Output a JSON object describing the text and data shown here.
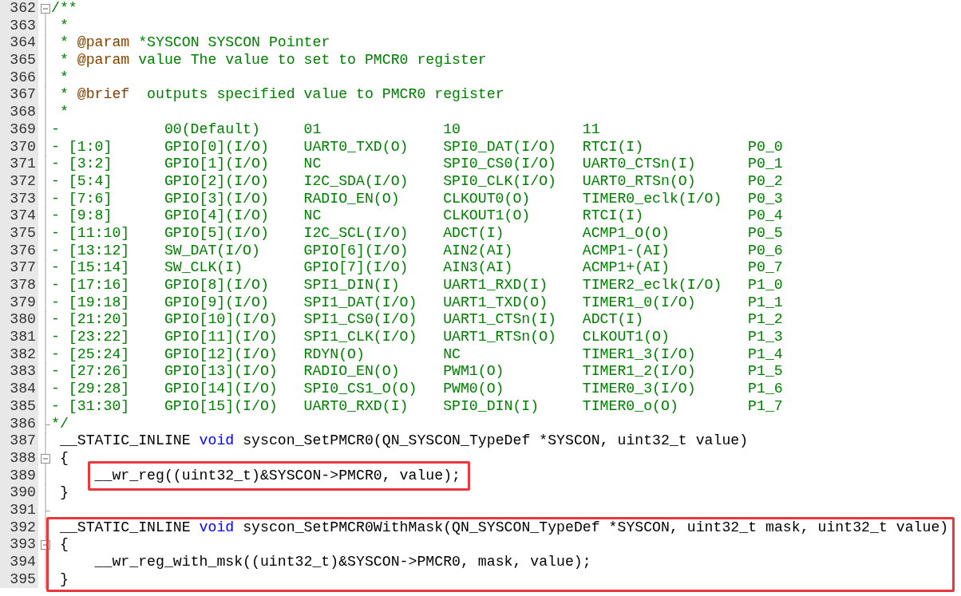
{
  "editor": {
    "blocks": [
      {
        "kind": "plain",
        "lines": [
          {
            "number": "362",
            "expanded": true,
            "segments": [
              {
                "kind": "comment",
                "text": "/**"
              }
            ]
          },
          {
            "number": "363",
            "segments": [
              {
                "kind": "comment",
                "text": " *"
              }
            ]
          },
          {
            "number": "364",
            "segments": [
              {
                "kind": "comment",
                "text": " * "
              },
              {
                "kind": "doctag",
                "text": "@param"
              },
              {
                "kind": "comment",
                "text": " *SYSCON SYSCON Pointer"
              }
            ]
          },
          {
            "number": "365",
            "segments": [
              {
                "kind": "comment",
                "text": " * "
              },
              {
                "kind": "doctag",
                "text": "@param"
              },
              {
                "kind": "comment",
                "text": " value The value to set to PMCR0 register"
              }
            ]
          },
          {
            "number": "366",
            "segments": [
              {
                "kind": "comment",
                "text": " *"
              }
            ]
          },
          {
            "number": "367",
            "segments": [
              {
                "kind": "comment",
                "text": " * "
              },
              {
                "kind": "doctag",
                "text": "@brief"
              },
              {
                "kind": "comment",
                "text": "  outputs specified value to PMCR0 register"
              }
            ]
          },
          {
            "number": "368",
            "segments": [
              {
                "kind": "comment",
                "text": " *"
              }
            ]
          },
          {
            "number": "369",
            "cells": [
              "-",
              "00(Default)",
              "01",
              "10",
              "11"
            ]
          },
          {
            "number": "370",
            "cells": [
              "- [1:0]",
              "GPIO[0](I/O)",
              "UART0_TXD(O)",
              "SPI0_DAT(I/O)",
              "RTCI(I)",
              "P0_0"
            ]
          },
          {
            "number": "371",
            "cells": [
              "- [3:2]",
              "GPIO[1](I/O)",
              "NC",
              "SPI0_CS0(I/O)",
              "UART0_CTSn(I)",
              "P0_1"
            ]
          },
          {
            "number": "372",
            "cells": [
              "- [5:4]",
              "GPIO[2](I/O)",
              "I2C_SDA(I/O)",
              "SPI0_CLK(I/O)",
              "UART0_RTSn(O)",
              "P0_2"
            ]
          },
          {
            "number": "373",
            "cells": [
              "- [7:6]",
              "GPIO[3](I/O)",
              "RADIO_EN(O)",
              "CLKOUT0(O)",
              "TIMER0_eclk(I/O)",
              "P0_3"
            ]
          },
          {
            "number": "374",
            "cells": [
              "- [9:8]",
              "GPIO[4](I/O)",
              "NC",
              "CLKOUT1(O)",
              "RTCI(I)",
              "P0_4"
            ]
          },
          {
            "number": "375",
            "cells": [
              "- [11:10]",
              "GPIO[5](I/O)",
              "I2C_SCL(I/O)",
              "ADCT(I)",
              "ACMP1_O(O)",
              "P0_5"
            ]
          },
          {
            "number": "376",
            "cells": [
              "- [13:12]",
              "SW_DAT(I/O)",
              "GPIO[6](I/O)",
              "AIN2(AI)",
              "ACMP1-(AI)",
              "P0_6"
            ]
          },
          {
            "number": "377",
            "cells": [
              "- [15:14]",
              "SW_CLK(I)",
              "GPIO[7](I/O)",
              "AIN3(AI)",
              "ACMP1+(AI)",
              "P0_7"
            ]
          },
          {
            "number": "378",
            "cells": [
              "- [17:16]",
              "GPIO[8](I/O)",
              "SPI1_DIN(I)",
              "UART1_RXD(I)",
              "TIMER2_eclk(I/O)",
              "P1_0"
            ]
          },
          {
            "number": "379",
            "cells": [
              "- [19:18]",
              "GPIO[9](I/O)",
              "SPI1_DAT(I/O)",
              "UART1_TXD(O)",
              "TIMER1_0(I/O)",
              "P1_1"
            ]
          },
          {
            "number": "380",
            "cells": [
              "- [21:20]",
              "GPIO[10](I/O)",
              "SPI1_CS0(I/O)",
              "UART1_CTSn(I)",
              "ADCT(I)",
              "P1_2"
            ]
          },
          {
            "number": "381",
            "cells": [
              "- [23:22]",
              "GPIO[11](I/O)",
              "SPI1_CLK(I/O)",
              "UART1_RTSn(O)",
              "CLKOUT1(O)",
              "P1_3"
            ]
          },
          {
            "number": "382",
            "cells": [
              "- [25:24]",
              "GPIO[12](I/O)",
              "RDYN(O)",
              "NC",
              "TIMER1_3(I/O)",
              "P1_4"
            ]
          },
          {
            "number": "383",
            "cells": [
              "- [27:26]",
              "GPIO[13](I/O)",
              "RADIO_EN(O)",
              "PWM1(O)",
              "TIMER1_2(I/O)",
              "P1_5"
            ]
          },
          {
            "number": "384",
            "cells": [
              "- [29:28]",
              "GPIO[14](I/O)",
              "SPI0_CS1_O(O)",
              "PWM0(O)",
              "TIMER0_3(I/O)",
              "P1_6"
            ]
          },
          {
            "number": "385",
            "cells": [
              "- [31:30]",
              "GPIO[15](I/O)",
              "UART0_RXD(I)",
              "SPI0_DIN(I)",
              "TIMER0_o(O)",
              "P1_7"
            ]
          },
          {
            "number": "386",
            "fold_end": true,
            "segments": [
              {
                "kind": "comment",
                "text": "*/"
              }
            ]
          },
          {
            "number": "387",
            "segments": [
              {
                "kind": "plain",
                "text": " __STATIC_INLINE "
              },
              {
                "kind": "keyword",
                "text": "void"
              },
              {
                "kind": "plain",
                "text": " syscon_SetPMCR0(QN_SYSCON_TypeDef *SYSCON, uint32_t value)"
              }
            ]
          },
          {
            "number": "388",
            "expanded": true,
            "segments": [
              {
                "kind": "plain",
                "text": " {"
              }
            ]
          }
        ]
      },
      {
        "kind": "boxed-text",
        "lines": [
          {
            "number": "389",
            "segments": [
              {
                "kind": "plain",
                "text": "     __wr_reg((uint32_t)&SYSCON->PMCR0, value);"
              }
            ]
          }
        ]
      },
      {
        "kind": "plain",
        "lines": [
          {
            "number": "390",
            "segments": [
              {
                "kind": "plain",
                "text": " }"
              }
            ]
          },
          {
            "number": "391",
            "fold_end": true
          }
        ]
      },
      {
        "kind": "boxed-block",
        "lines": [
          {
            "number": "392",
            "segments": [
              {
                "kind": "plain",
                "text": " __STATIC_INLINE "
              },
              {
                "kind": "keyword",
                "text": "void"
              },
              {
                "kind": "plain",
                "text": " syscon_SetPMCR0WithMask(QN_SYSCON_TypeDef *SYSCON, uint32_t mask, uint32_t value)"
              }
            ]
          },
          {
            "number": "393",
            "expanded": true,
            "segments": [
              {
                "kind": "plain",
                "text": " {"
              }
            ]
          },
          {
            "number": "394",
            "segments": [
              {
                "kind": "plain",
                "text": "     __wr_reg_with_msk((uint32_t)&SYSCON->PMCR0, mask, value);"
              }
            ]
          },
          {
            "number": "395",
            "segments": [
              {
                "kind": "plain",
                "text": " }"
              }
            ]
          }
        ]
      }
    ]
  }
}
